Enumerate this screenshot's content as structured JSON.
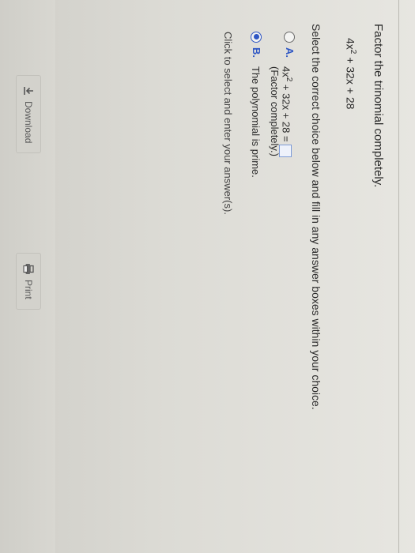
{
  "question": {
    "prompt": "Factor the trinomial completely.",
    "expression_base": "4x",
    "expression_exp": "2",
    "expression_rest": " + 32x + 28"
  },
  "instruction": "Select the correct choice below and fill in any answer boxes within your choice.",
  "choices": [
    {
      "letter": "A.",
      "line1_base": "4x",
      "line1_exp": "2",
      "line1_rest": " + 32x + 28 =",
      "line2": "(Factor completely.)",
      "selected": false
    },
    {
      "letter": "B.",
      "line1": "The polynomial is prime.",
      "selected": true
    }
  ],
  "hint": "Click to select and enter your answer(s).",
  "buttons": {
    "download": "Download",
    "print": "Print"
  },
  "colors": {
    "accent": "#2f57c4"
  },
  "icons": {
    "download": "download-icon",
    "print": "printer-icon"
  }
}
